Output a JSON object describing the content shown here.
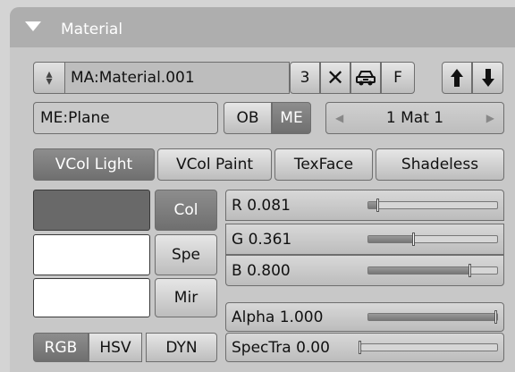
{
  "panel": {
    "title": "Material"
  },
  "selector": {
    "material_name": "MA:Material.001",
    "users_count": "3",
    "fake_user_label": "F",
    "icons": [
      "updown-icon",
      "delete-icon",
      "car-icon",
      "up-arrow-icon",
      "down-arrow-icon"
    ]
  },
  "link": {
    "mesh_name": "ME:Plane",
    "ob_label": "OB",
    "me_label": "ME",
    "mat_index": "1 Mat 1"
  },
  "modes": {
    "vcol_light": "VCol Light",
    "vcol_paint": "VCol Paint",
    "texface": "TexFace",
    "shadeless": "Shadeless"
  },
  "colors": {
    "col_label": "Col",
    "spe_label": "Spe",
    "mir_label": "Mir",
    "col_swatch": "#696969",
    "spe_swatch": "#ffffff",
    "mir_swatch": "#ffffff"
  },
  "sliders": {
    "r": {
      "label": "R 0.081",
      "value": 0.081
    },
    "g": {
      "label": "G 0.361",
      "value": 0.361
    },
    "b": {
      "label": "B 0.800",
      "value": 0.8
    },
    "alpha": {
      "label": "Alpha 1.000",
      "value": 1.0
    },
    "spectra": {
      "label": "SpecTra 0.00",
      "value": 0.0
    }
  },
  "color_model": {
    "rgb": "RGB",
    "hsv": "HSV",
    "dyn": "DYN"
  }
}
